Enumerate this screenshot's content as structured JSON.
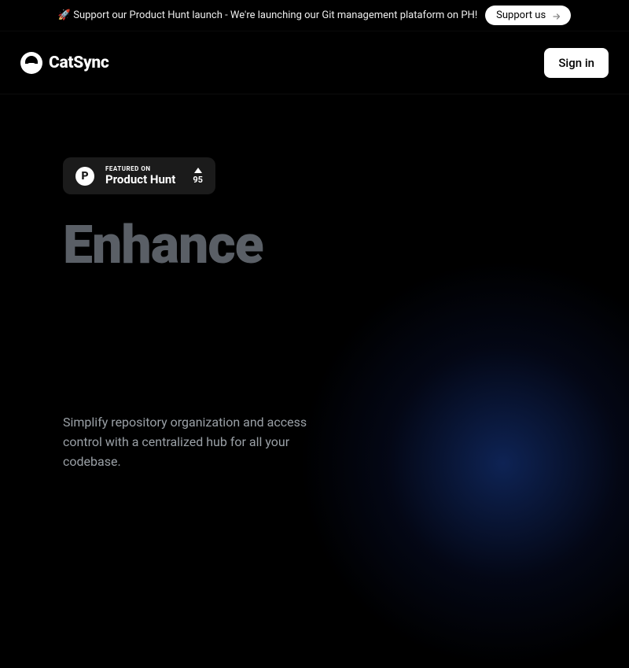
{
  "announce": {
    "text": "🚀 Support our Product Hunt launch - We're launching our Git management plataform on PH!",
    "button": "Support us"
  },
  "header": {
    "brand": "CatSync",
    "signin": "Sign in"
  },
  "hero": {
    "badge": {
      "featured": "FEATURED ON",
      "platform": "Product Hunt",
      "p_letter": "P",
      "votes": "95"
    },
    "title": "Enhance",
    "subtitle": "Simplify repository organization and access control with a centralized hub for all your codebase."
  }
}
